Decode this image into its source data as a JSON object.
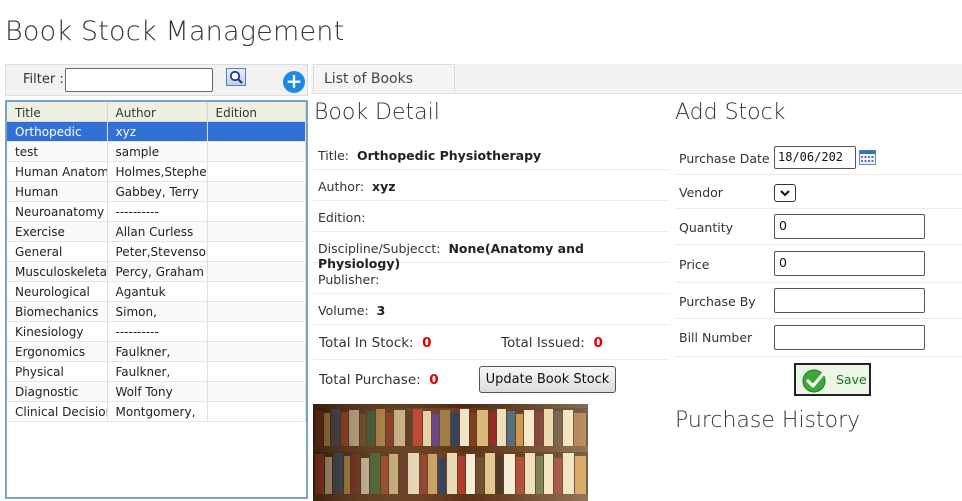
{
  "page": {
    "title": "Book Stock Management"
  },
  "filter": {
    "label": "Filter :",
    "value": "",
    "placeholder": ""
  },
  "tabs": [
    {
      "label": "List of Books"
    }
  ],
  "book_table": {
    "columns": [
      "Title",
      "Author",
      "Edition"
    ],
    "rows": [
      {
        "title": "Orthopedic",
        "author": "xyz",
        "edition": ""
      },
      {
        "title": "test",
        "author": "sample",
        "edition": ""
      },
      {
        "title": "Human Anatomy",
        "author": "Holmes,Stephen",
        "edition": ""
      },
      {
        "title": "Human",
        "author": "Gabbey, Terry",
        "edition": ""
      },
      {
        "title": "Neuroanatomy",
        "author": "----------",
        "edition": ""
      },
      {
        "title": "Exercise",
        "author": "Allan Curless",
        "edition": ""
      },
      {
        "title": "General",
        "author": "Peter,Stevenson",
        "edition": ""
      },
      {
        "title": "Musculoskeletal",
        "author": "Percy, Graham",
        "edition": ""
      },
      {
        "title": "Neurological",
        "author": "Agantuk",
        "edition": ""
      },
      {
        "title": "Biomechanics",
        "author": "Simon,",
        "edition": ""
      },
      {
        "title": "Kinesiology",
        "author": "----------",
        "edition": ""
      },
      {
        "title": "Ergonomics",
        "author": "Faulkner,",
        "edition": ""
      },
      {
        "title": "Physical",
        "author": "Faulkner,",
        "edition": ""
      },
      {
        "title": "Diagnostic",
        "author": "Wolf Tony",
        "edition": ""
      },
      {
        "title": "Clinical Decision",
        "author": "Montgomery,",
        "edition": ""
      }
    ]
  },
  "book_detail": {
    "heading": "Book Detail",
    "title_label": "Title:",
    "title_value": "Orthopedic Physiotherapy",
    "author_label": "Author:",
    "author_value": "xyz",
    "edition_label": "Edition:",
    "edition_value": "",
    "discipline_label": "Discipline/Subjecct:",
    "discipline_value": "None(Anatomy and Physiology)",
    "publisher_label": "Publisher:",
    "publisher_value": "",
    "volume_label": "Volume:",
    "volume_value": "3",
    "total_in_stock_label": "Total In Stock:",
    "total_in_stock_value": "0",
    "total_issued_label": "Total Issued:",
    "total_issued_value": "0",
    "total_purchase_label": "Total Purchase:",
    "total_purchase_value": "0",
    "update_button": "Update Book Stock"
  },
  "add_stock": {
    "heading": "Add Stock",
    "purchase_date_label": "Purchase Date",
    "purchase_date_value": "18/06/202",
    "vendor_label": "Vendor",
    "vendor_value": "",
    "quantity_label": "Quantity",
    "quantity_value": "0",
    "price_label": "Price",
    "price_value": "0",
    "purchase_by_label": "Purchase By",
    "purchase_by_value": "",
    "bill_number_label": "Bill Number",
    "bill_number_value": "",
    "save_button": "Save"
  },
  "purchase_history": {
    "heading": "Purchase History"
  },
  "colors": {
    "selected_row": "#3370d6",
    "accent_blue": "#1e88e5",
    "value_red": "#e00000",
    "save_green": "#3aa935"
  },
  "icons": {
    "search": "search-icon",
    "add": "plus-circle-icon",
    "calendar": "calendar-icon",
    "save": "check-icon"
  }
}
